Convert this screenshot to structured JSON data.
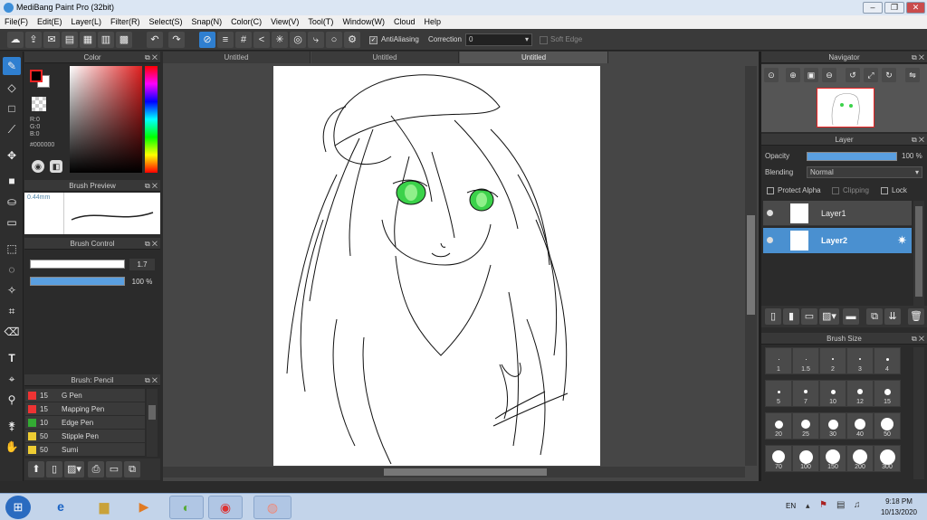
{
  "window": {
    "title": "MediBang Paint Pro (32bit)"
  },
  "menu": [
    "File(F)",
    "Edit(E)",
    "Layer(L)",
    "Filter(R)",
    "Select(S)",
    "Snap(N)",
    "Color(C)",
    "View(V)",
    "Tool(T)",
    "Window(W)",
    "Cloud",
    "Help"
  ],
  "toolbar": {
    "antialiasing_label": "AntiAliasing",
    "correction_label": "Correction",
    "correction_value": "0",
    "soft_edge_label": "Soft Edge"
  },
  "color_panel": {
    "title": "Color",
    "r": "R:0",
    "g": "G:0",
    "b": "B:0",
    "hex": "#000000"
  },
  "brush_preview": {
    "title": "Brush Preview",
    "size": "0.44mm"
  },
  "brush_control": {
    "title": "Brush Control",
    "size_value": "1.7",
    "opacity_value": "100 %",
    "opacity_fraction": 1.0
  },
  "brush_list": {
    "title": "Brush: Pencil",
    "items": [
      {
        "size": "15",
        "name": "G Pen",
        "color": "#e33"
      },
      {
        "size": "15",
        "name": "Mapping Pen",
        "color": "#e33"
      },
      {
        "size": "10",
        "name": "Edge Pen",
        "color": "#3a3"
      },
      {
        "size": "50",
        "name": "Stipple Pen",
        "color": "#ec3"
      },
      {
        "size": "50",
        "name": "Sumi",
        "color": "#ec3"
      }
    ]
  },
  "tabs": [
    "Untitled",
    "Untitled",
    "Untitled"
  ],
  "navigator": {
    "title": "Navigator"
  },
  "layer_panel": {
    "title": "Layer",
    "opacity_label": "Opacity",
    "opacity_value": "100 %",
    "blending_label": "Blending",
    "blending_value": "Normal",
    "protect_alpha": "Protect Alpha",
    "clipping": "Clipping",
    "lock": "Lock",
    "layers": [
      {
        "name": "Layer1"
      },
      {
        "name": "Layer2"
      }
    ]
  },
  "brush_size": {
    "title": "Brush Size",
    "sizes": [
      "1",
      "1.5",
      "2",
      "3",
      "4",
      "5",
      "7",
      "10",
      "12",
      "15",
      "20",
      "25",
      "30",
      "40",
      "50",
      "70",
      "100",
      "150",
      "200",
      "300"
    ]
  },
  "taskbar": {
    "lang": "EN",
    "time": "9:18 PM",
    "date": "10/13/2020"
  },
  "colors": {
    "accent": "#2f7fd0",
    "selected_layer": "#4a90d0"
  }
}
